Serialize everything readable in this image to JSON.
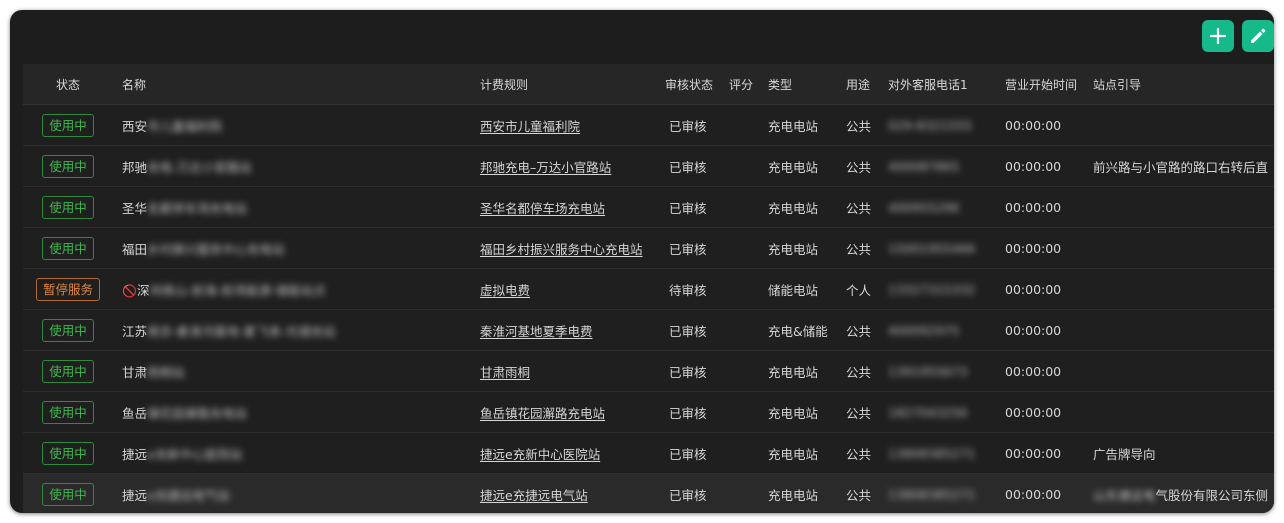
{
  "toolbar": {
    "add_icon": "plus-icon",
    "edit_icon": "pencil-icon",
    "accent": "#16b98a"
  },
  "table": {
    "columns": [
      "状态",
      "名称",
      "计费规则",
      "审核状态",
      "评分",
      "类型",
      "用途",
      "对外客服电话1",
      "营业开始时间",
      "站点引导"
    ],
    "rows": [
      {
        "status": "使用中",
        "status_kind": "ok",
        "name_prefix": "",
        "name": "西安",
        "name_hidden": "市儿童福利院",
        "rule": "西安市儿童福利院",
        "audit": "已审核",
        "score": "",
        "type": "充电电站",
        "use": "公共",
        "phone": "029-8321555",
        "open": "00:00:00",
        "guide": "",
        "guide_hidden": ""
      },
      {
        "status": "使用中",
        "status_kind": "ok",
        "name_prefix": "",
        "name": "邦驰",
        "name_hidden": "充电-万达小官路站",
        "rule": "邦驰充电–万达小官路站",
        "audit": "已审核",
        "score": "",
        "type": "充电电站",
        "use": "公共",
        "phone": "400087865",
        "open": "00:00:00",
        "guide": "前兴路与小官路的路口右转后直",
        "guide_hidden": ""
      },
      {
        "status": "使用中",
        "status_kind": "ok",
        "name_prefix": "",
        "name": "圣华",
        "name_hidden": "名都停车场充电站",
        "rule": "圣华名都停车场充电站",
        "audit": "已审核",
        "score": "",
        "type": "充电电站",
        "use": "公共",
        "phone": "400955296",
        "open": "00:00:00",
        "guide": "",
        "guide_hidden": ""
      },
      {
        "status": "使用中",
        "status_kind": "ok",
        "name_prefix": "",
        "name": "福田",
        "name_hidden": "乡村振兴服务中心充电站",
        "rule": "福田乡村振兴服务中心充电站",
        "audit": "已审核",
        "score": "",
        "type": "充电电站",
        "use": "公共",
        "phone": "15001955466",
        "open": "00:00:00",
        "guide": "",
        "guide_hidden": ""
      },
      {
        "status": "暂停服务",
        "status_kind": "stop",
        "name_prefix": "🚫",
        "name": "深",
        "name_hidden": "圳南山-前海-前湾能源-储能站点",
        "rule": "虚拟电费",
        "audit": "待审核",
        "score": "",
        "type": "储能电站",
        "use": "个人",
        "phone": "13327315332",
        "open": "00:00:00",
        "guide": "",
        "guide_hidden": ""
      },
      {
        "status": "使用中",
        "status_kind": "ok",
        "name_prefix": "",
        "name": "江苏",
        "name_hidden": "南京-秦淮河基地-夏飞来-光储充站",
        "rule": "秦淮河基地夏季电费",
        "audit": "已审核",
        "score": "",
        "type": "充电&储能",
        "use": "公共",
        "phone": "400092975",
        "open": "00:00:00",
        "guide": "",
        "guide_hidden": ""
      },
      {
        "status": "使用中",
        "status_kind": "ok",
        "name_prefix": "",
        "name": "甘肃",
        "name_hidden": "雨桐站",
        "rule": "甘肃雨桐",
        "audit": "已审核",
        "score": "",
        "type": "充电电站",
        "use": "公共",
        "phone": "1391955673",
        "open": "00:00:00",
        "guide": "",
        "guide_hidden": ""
      },
      {
        "status": "使用中",
        "status_kind": "ok",
        "name_prefix": "",
        "name": "鱼岳",
        "name_hidden": "镇花园澥路充电站",
        "rule": "鱼岳镇花园澥路充电站",
        "audit": "已审核",
        "score": "",
        "type": "充电电站",
        "use": "公共",
        "phone": "1827043256",
        "open": "00:00:00",
        "guide": "",
        "guide_hidden": ""
      },
      {
        "status": "使用中",
        "status_kind": "ok",
        "name_prefix": "",
        "name": "捷远",
        "name_hidden": "e充新中心医院站",
        "rule": "捷远e充新中心医院站",
        "audit": "已审核",
        "score": "",
        "type": "充电电站",
        "use": "公共",
        "phone": "13808385271",
        "open": "00:00:00",
        "guide": "广告牌导向",
        "guide_hidden": ""
      },
      {
        "status": "使用中",
        "status_kind": "ok",
        "name_prefix": "",
        "name": "捷远",
        "name_hidden": "e充捷远电气站",
        "rule": "捷远e充捷远电气站",
        "audit": "已审核",
        "score": "",
        "type": "充电电站",
        "use": "公共",
        "phone": "13808385271",
        "open": "00:00:00",
        "guide": "气股份有限公司东侧",
        "guide_hidden": "山东捷远电"
      }
    ]
  }
}
